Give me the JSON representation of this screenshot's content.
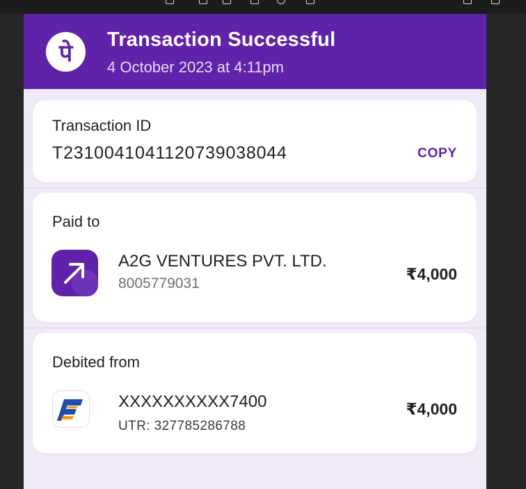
{
  "header": {
    "logo_glyph": "पे",
    "title": "Transaction Successful",
    "datetime": "4 October 2023 at 4:11pm"
  },
  "transaction": {
    "label": "Transaction ID",
    "id": "T2310041041120739038044",
    "copy_label": "COPY"
  },
  "paid_to": {
    "label": "Paid to",
    "name": "A2G VENTURES PVT. LTD.",
    "phone": "8005779031",
    "amount": "₹4,000",
    "icon": "arrow-up-right-icon"
  },
  "debited_from": {
    "label": "Debited from",
    "account": "XXXXXXXXXX7400",
    "utr": "UTR: 327785286788",
    "amount": "₹4,000",
    "icon": "bank-logo-icon"
  },
  "colors": {
    "brand": "#5f22a9",
    "background": "#efe9f8"
  }
}
